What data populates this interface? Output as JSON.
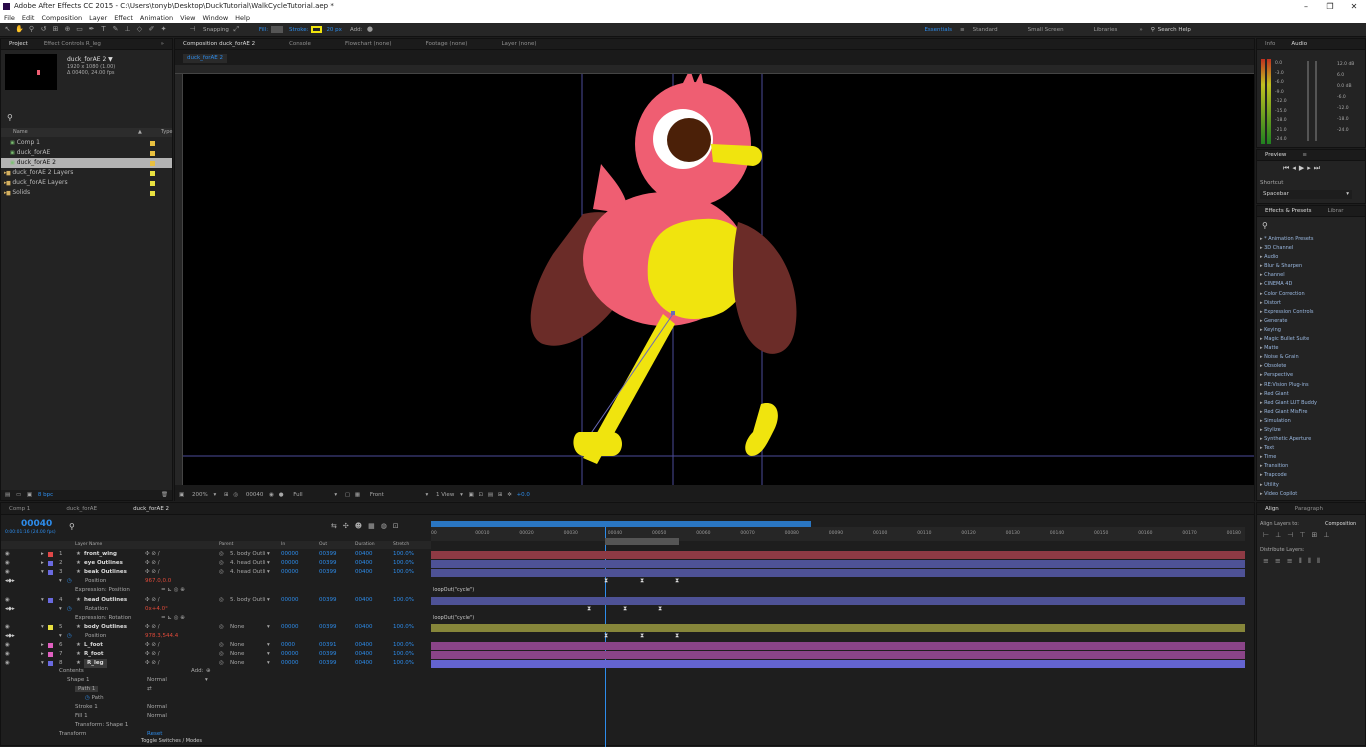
{
  "titlebar": {
    "title": "Adobe After Effects CC 2015 - C:\\Users\\tonyb\\Desktop\\DuckTutorial\\WalkCycleTutorial.aep *",
    "min": "–",
    "max": "❐",
    "close": "✕"
  },
  "menu": [
    "File",
    "Edit",
    "Composition",
    "Layer",
    "Effect",
    "Animation",
    "View",
    "Window",
    "Help"
  ],
  "toolbar": {
    "snapping": "Snapping",
    "fill": "Fill:",
    "stroke": "Stroke:",
    "stroke_px": "20 px",
    "add": "Add:",
    "workspaces": [
      "Essentials",
      "Standard",
      "Small Screen",
      "Libraries"
    ],
    "search": "Search Help"
  },
  "project": {
    "tab": "Project",
    "tab2": "Effect Controls R_leg",
    "item_name": "duck_forAE 2 ▼",
    "item_info1": "1920 x 1080 (1.00)",
    "item_info2": "Δ 00400, 24.00 fps",
    "col_name": "Name",
    "col_type": "Type",
    "bpc": "8 bpc",
    "items": [
      {
        "label": "Comp 1",
        "color": "#e8c040",
        "kind": "comp"
      },
      {
        "label": "duck_forAE",
        "color": "#e8c040",
        "kind": "comp"
      },
      {
        "label": "duck_forAE 2",
        "color": "#e8c040",
        "kind": "comp",
        "selected": true
      },
      {
        "label": "duck_forAE 2 Layers",
        "color": "#e8e040",
        "kind": "folder"
      },
      {
        "label": "duck_forAE Layers",
        "color": "#e8e040",
        "kind": "folder"
      },
      {
        "label": "Solids",
        "color": "#e8e040",
        "kind": "folder"
      }
    ]
  },
  "viewer": {
    "tabs": [
      "Composition duck_forAE 2",
      "Console",
      "Flowchart (none)",
      "Footage (none)",
      "Layer (none)"
    ],
    "subtab": "duck_forAE 2",
    "zoom": "200%",
    "frame": "00040",
    "res": "Full",
    "view": "Front",
    "views": "1 View",
    "exposure": "+0.0"
  },
  "rightpanels": {
    "info": "Info",
    "audio": "Audio",
    "audio_left": [
      "0.0",
      "-3.0",
      "-6.0",
      "-9.0",
      "-12.0",
      "-15.0",
      "-18.0",
      "-21.0",
      "-24.0"
    ],
    "audio_right": [
      "12.0 dB",
      "6.0",
      "0.0 dB",
      "-6.0",
      "-12.0",
      "-18.0",
      "-24.0"
    ],
    "preview": "Preview",
    "shortcut": "Shortcut",
    "spacebar": "Spacebar",
    "effects": "Effects & Presets",
    "libraries": "Librar",
    "effects_list": [
      "* Animation Presets",
      "3D Channel",
      "Audio",
      "Blur & Sharpen",
      "Channel",
      "CINEMA 4D",
      "Color Correction",
      "Distort",
      "Expression Controls",
      "Generate",
      "Keying",
      "Magic Bullet Suite",
      "Matte",
      "Noise & Grain",
      "Obsolete",
      "Perspective",
      "RE:Vision Plug-ins",
      "Red Giant",
      "Red Giant LUT Buddy",
      "Red Giant MisFire",
      "Simulation",
      "Stylize",
      "Synthetic Aperture",
      "Text",
      "Time",
      "Transition",
      "Trapcode",
      "Utility",
      "Video Copilot"
    ],
    "align": "Align",
    "paragraph": "Paragraph",
    "align_to": "Align Layers to:",
    "composition": "Composition",
    "distribute": "Distribute Layers:"
  },
  "timeline": {
    "tabs": [
      "Comp 1",
      "duck_forAE",
      "duck_forAE 2"
    ],
    "timecode": "00040",
    "subtime": "0:00:01:16 (24.00 fps)",
    "toggle": "Toggle Switches / Modes",
    "cols": [
      "Layer Name",
      "Parent",
      "In",
      "Out",
      "Duration",
      "Stretch"
    ],
    "ruler": [
      "00",
      "00010",
      "00020",
      "00030",
      "00040",
      "00050",
      "00060",
      "00070",
      "00080",
      "00090",
      "00100",
      "00110",
      "00120",
      "00130",
      "00140",
      "00150",
      "00160",
      "00170",
      "00180"
    ],
    "layers": [
      {
        "num": "1",
        "name": "front_wing",
        "color": "#e04848",
        "parent": "5. body Outli",
        "in": "00000",
        "out": "00399",
        "dur": "00400",
        "str": "100.0%",
        "bar": "#8e3a44"
      },
      {
        "num": "2",
        "name": "eye Outlines",
        "color": "#6a6ae0",
        "parent": "4. head Outli",
        "in": "00000",
        "out": "00399",
        "dur": "00400",
        "str": "100.0%",
        "bar": "#4e5296"
      },
      {
        "num": "3",
        "name": "beak Outlines",
        "color": "#6a6ae0",
        "parent": "4. head Outli",
        "in": "00000",
        "out": "00399",
        "dur": "00400",
        "str": "100.0%",
        "bar": "#4e5296"
      },
      {
        "prop": "Position",
        "val": "967.0,0.0"
      },
      {
        "expr": "Expression: Position",
        "text": "loopOut(\"cycle\")"
      },
      {
        "num": "4",
        "name": "head Outlines",
        "color": "#6a6ae0",
        "parent": "5. body Outli",
        "in": "00000",
        "out": "00399",
        "dur": "00400",
        "str": "100.0%",
        "bar": "#4e5296"
      },
      {
        "prop": "Rotation",
        "val": "0x+4.0°"
      },
      {
        "expr": "Expression: Rotation",
        "text": "loopOut(\"cycle\")"
      },
      {
        "num": "5",
        "name": "body Outlines",
        "color": "#e8e040",
        "parent": "None",
        "in": "00000",
        "out": "00399",
        "dur": "00400",
        "str": "100.0%",
        "bar": "#86863a"
      },
      {
        "prop": "Position",
        "val": "978.3,544.4"
      },
      {
        "num": "6",
        "name": "L_foot",
        "color": "#e060c0",
        "parent": "None",
        "in": "0000",
        "out": "00391",
        "dur": "00400",
        "str": "100.0%",
        "bar": "#8a4488"
      },
      {
        "num": "7",
        "name": "R_foot",
        "color": "#e060c0",
        "parent": "None",
        "in": "00000",
        "out": "00399",
        "dur": "00400",
        "str": "100.0%",
        "bar": "#8a4488"
      },
      {
        "num": "8",
        "name": "R_leg",
        "color": "#6a6ae0",
        "parent": "None",
        "in": "00000",
        "out": "00399",
        "dur": "00400",
        "str": "100.0%",
        "bar": "#6464d0"
      }
    ],
    "contents": "Contents",
    "add": "Add:",
    "shape1": "Shape 1",
    "path1": "Path 1",
    "path": "Path",
    "stroke1": "Stroke 1",
    "fill1": "Fill 1",
    "transform_shape": "Transform: Shape 1",
    "transform": "Transform",
    "reset": "Reset",
    "normal": "Normal"
  },
  "colors": {
    "duck_body": "#ef5e72",
    "duck_belly": "#f0e40e",
    "wing": "#6b2c28",
    "eye_dark": "#4b2008",
    "leg": "#f0e40e",
    "accent": "#2d8ceb"
  }
}
